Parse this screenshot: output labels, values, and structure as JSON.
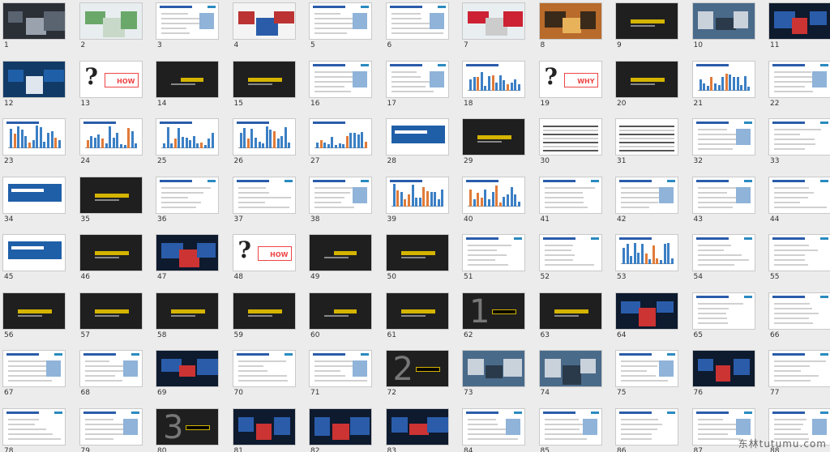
{
  "watermark": "东林tutumu.com",
  "slides": [
    {
      "n": "1",
      "t": "photo-dark"
    },
    {
      "n": "2",
      "t": "plant"
    },
    {
      "n": "3",
      "t": "doc"
    },
    {
      "n": "4",
      "t": "cars"
    },
    {
      "n": "5",
      "t": "doc"
    },
    {
      "n": "6",
      "t": "doc"
    },
    {
      "n": "7",
      "t": "stairs"
    },
    {
      "n": "8",
      "t": "sunset"
    },
    {
      "n": "9",
      "t": "dark"
    },
    {
      "n": "10",
      "t": "photo"
    },
    {
      "n": "11",
      "t": "darkphoto"
    },
    {
      "n": "12",
      "t": "dashboard"
    },
    {
      "n": "13",
      "t": "q"
    },
    {
      "n": "14",
      "t": "menu"
    },
    {
      "n": "15",
      "t": "dark"
    },
    {
      "n": "16",
      "t": "doc"
    },
    {
      "n": "17",
      "t": "doc"
    },
    {
      "n": "18",
      "t": "chart"
    },
    {
      "n": "19",
      "t": "q"
    },
    {
      "n": "20",
      "t": "dark"
    },
    {
      "n": "21",
      "t": "chart"
    },
    {
      "n": "22",
      "t": "doc"
    },
    {
      "n": "23",
      "t": "chart"
    },
    {
      "n": "24",
      "t": "chart"
    },
    {
      "n": "25",
      "t": "chart"
    },
    {
      "n": "26",
      "t": "chart"
    },
    {
      "n": "27",
      "t": "chart"
    },
    {
      "n": "28",
      "t": "blue"
    },
    {
      "n": "29",
      "t": "dark"
    },
    {
      "n": "30",
      "t": "table"
    },
    {
      "n": "31",
      "t": "table"
    },
    {
      "n": "32",
      "t": "doc"
    },
    {
      "n": "33",
      "t": "doc"
    },
    {
      "n": "34",
      "t": "blue"
    },
    {
      "n": "35",
      "t": "dark"
    },
    {
      "n": "36",
      "t": "doc"
    },
    {
      "n": "37",
      "t": "doc"
    },
    {
      "n": "38",
      "t": "doc"
    },
    {
      "n": "39",
      "t": "chart"
    },
    {
      "n": "40",
      "t": "chart"
    },
    {
      "n": "41",
      "t": "doc"
    },
    {
      "n": "42",
      "t": "doc"
    },
    {
      "n": "43",
      "t": "doc"
    },
    {
      "n": "44",
      "t": "doc"
    },
    {
      "n": "45",
      "t": "blue"
    },
    {
      "n": "46",
      "t": "dark"
    },
    {
      "n": "47",
      "t": "darkphoto"
    },
    {
      "n": "48",
      "t": "q"
    },
    {
      "n": "49",
      "t": "menu"
    },
    {
      "n": "50",
      "t": "dark"
    },
    {
      "n": "51",
      "t": "doc"
    },
    {
      "n": "52",
      "t": "doc"
    },
    {
      "n": "53",
      "t": "chart"
    },
    {
      "n": "54",
      "t": "doc"
    },
    {
      "n": "55",
      "t": "doc"
    },
    {
      "n": "56",
      "t": "dark"
    },
    {
      "n": "57",
      "t": "dark"
    },
    {
      "n": "58",
      "t": "dark"
    },
    {
      "n": "59",
      "t": "dark"
    },
    {
      "n": "60",
      "t": "menu"
    },
    {
      "n": "61",
      "t": "dark"
    },
    {
      "n": "62",
      "t": "big"
    },
    {
      "n": "63",
      "t": "dark"
    },
    {
      "n": "64",
      "t": "darkphoto"
    },
    {
      "n": "65",
      "t": "doc"
    },
    {
      "n": "66",
      "t": "doc"
    },
    {
      "n": "67",
      "t": "doc"
    },
    {
      "n": "68",
      "t": "doc"
    },
    {
      "n": "69",
      "t": "darkphoto"
    },
    {
      "n": "70",
      "t": "doc"
    },
    {
      "n": "71",
      "t": "doc"
    },
    {
      "n": "72",
      "t": "big"
    },
    {
      "n": "73",
      "t": "photo"
    },
    {
      "n": "74",
      "t": "photo"
    },
    {
      "n": "75",
      "t": "doc"
    },
    {
      "n": "76",
      "t": "darkphoto"
    },
    {
      "n": "77",
      "t": "doc"
    },
    {
      "n": "78",
      "t": "doc"
    },
    {
      "n": "79",
      "t": "doc"
    },
    {
      "n": "80",
      "t": "big"
    },
    {
      "n": "81",
      "t": "darkphoto"
    },
    {
      "n": "82",
      "t": "darkphoto"
    },
    {
      "n": "83",
      "t": "darkphoto"
    },
    {
      "n": "84",
      "t": "doc"
    },
    {
      "n": "85",
      "t": "doc"
    },
    {
      "n": "86",
      "t": "doc"
    },
    {
      "n": "87",
      "t": "doc"
    },
    {
      "n": "88",
      "t": "doc"
    }
  ],
  "labels": {
    "q13": "HOW",
    "q19": "WHY",
    "q48": "HOW"
  }
}
